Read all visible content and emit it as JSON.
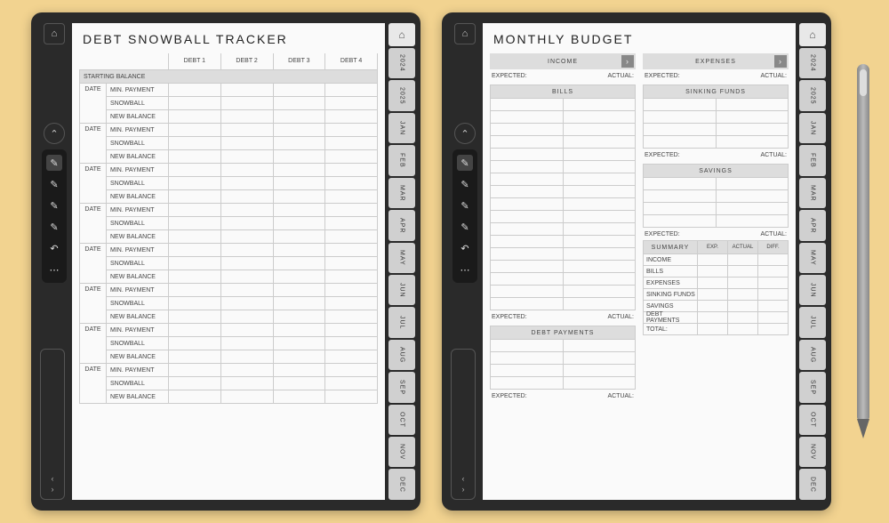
{
  "side_tabs": [
    "2024",
    "2025",
    "JAN",
    "FEB",
    "MAR",
    "APR",
    "MAY",
    "JUN",
    "JUL",
    "AUG",
    "SEP",
    "OCT",
    "NOV",
    "DEC"
  ],
  "home_icon": "⌂",
  "toolbar": {
    "up": "⌃",
    "tools": [
      "✎",
      "✎",
      "✎",
      "✎",
      "↶",
      "⋯"
    ]
  },
  "debt": {
    "title": "DEBT SNOWBALL TRACKER",
    "cols": [
      "DEBT 1",
      "DEBT 2",
      "DEBT 3",
      "DEBT 4"
    ],
    "starting": "STARTING BALANCE",
    "date": "DATE",
    "rows": [
      "MIN. PAYMENT",
      "SNOWBALL",
      "NEW BALANCE"
    ],
    "groups": 8
  },
  "budget": {
    "title": "MONTHLY BUDGET",
    "income": "INCOME",
    "expenses": "EXPENSES",
    "expected": "EXPECTED:",
    "actual": "ACTUAL:",
    "bills": "BILLS",
    "sinking": "SINKING FUNDS",
    "savings": "SAVINGS",
    "debt_payments": "DEBT PAYMENTS",
    "summary": "SUMMARY",
    "sum_cols": [
      "EXP.",
      "ACTUAL",
      "DIFF."
    ],
    "sum_rows": [
      "INCOME",
      "BILLS",
      "EXPENSES",
      "SINKING FUNDS",
      "SAVINGS",
      "DEBT PAYMENTS",
      "TOTAL:"
    ]
  }
}
